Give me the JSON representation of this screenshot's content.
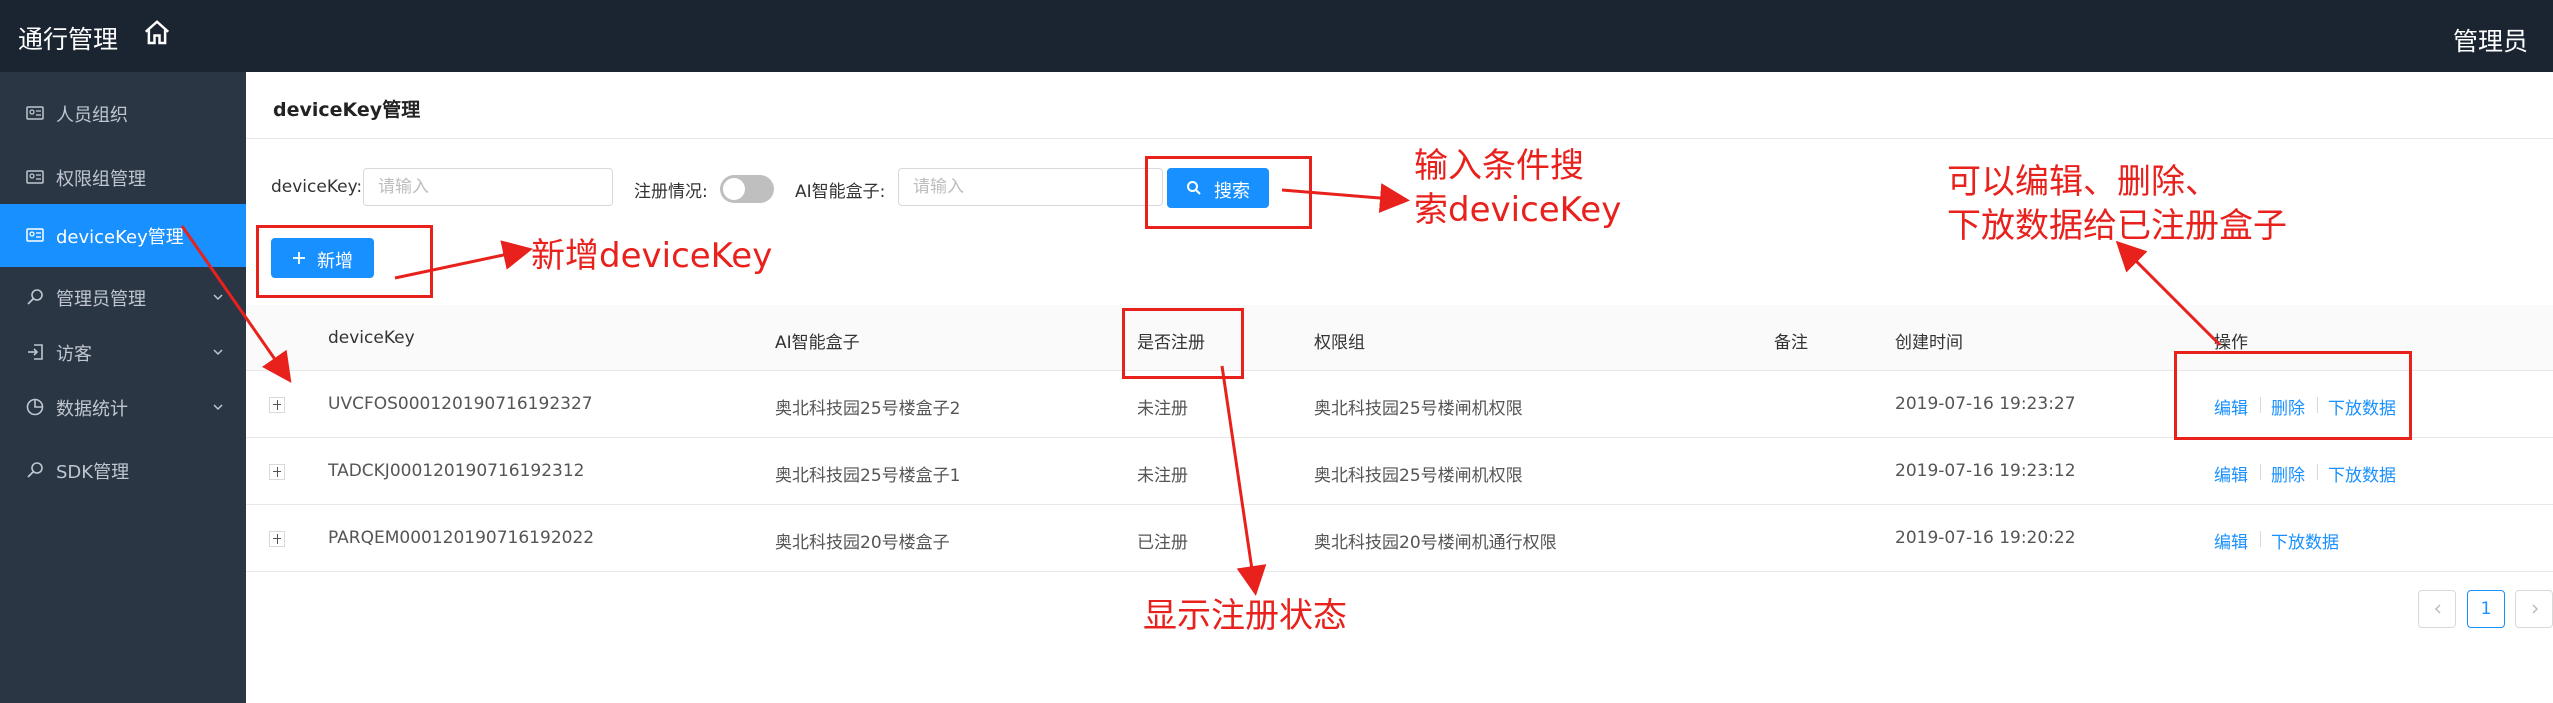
{
  "app": {
    "title": "通行管理",
    "user": "管理员"
  },
  "sidebar": {
    "items": [
      {
        "label": "人员组织",
        "icon": "id-card-icon"
      },
      {
        "label": "权限组管理",
        "icon": "id-card-icon"
      },
      {
        "label": "deviceKey管理",
        "icon": "id-card-icon",
        "active": true
      },
      {
        "label": "管理员管理",
        "icon": "key-icon",
        "expandable": true
      },
      {
        "label": "访客",
        "icon": "login-icon",
        "expandable": true
      },
      {
        "label": "数据统计",
        "icon": "pie-chart-icon",
        "expandable": true
      },
      {
        "label": "SDK管理",
        "icon": "key-icon"
      }
    ]
  },
  "page": {
    "title": "deviceKey管理"
  },
  "filters": {
    "devicekey_label": "deviceKey:",
    "devicekey_placeholder": "请输入",
    "register_label": "注册情况:",
    "box_label": "AI智能盒子:",
    "box_placeholder": "请输入",
    "search_button": "搜索",
    "add_button": "新增"
  },
  "table": {
    "headers": [
      "deviceKey",
      "AI智能盒子",
      "是否注册",
      "权限组",
      "备注",
      "创建时间",
      "操作"
    ],
    "rows": [
      {
        "devicekey": "UVCFOS000120190716192327",
        "box": "奥北科技园25号楼盒子2",
        "registered": "未注册",
        "group": "奥北科技园25号楼闸机权限",
        "note": "",
        "created": "2019-07-16 19:23:27",
        "actions": [
          "编辑",
          "删除",
          "下放数据"
        ]
      },
      {
        "devicekey": "TADCKJ000120190716192312",
        "box": "奥北科技园25号楼盒子1",
        "registered": "未注册",
        "group": "奥北科技园25号楼闸机权限",
        "note": "",
        "created": "2019-07-16 19:23:12",
        "actions": [
          "编辑",
          "删除",
          "下放数据"
        ]
      },
      {
        "devicekey": "PARQEM000120190716192022",
        "box": "奥北科技园20号楼盒子",
        "registered": "已注册",
        "group": "奥北科技园20号楼闸机通行权限",
        "note": "",
        "created": "2019-07-16 19:20:22",
        "actions": [
          "编辑",
          "下放数据"
        ]
      }
    ]
  },
  "pagination": {
    "current": "1"
  },
  "annotations": {
    "search_line1": "输入条件搜",
    "search_line2": "索deviceKey",
    "add": "新增deviceKey",
    "ops_line1": "可以编辑、删除、",
    "ops_line2": "下放数据给已注册盒子",
    "status": "显示注册状态"
  },
  "colors": {
    "primary": "#1890ff",
    "annotation": "#e8211d",
    "topbar": "#1b2431",
    "sidebar": "#2b3645"
  }
}
